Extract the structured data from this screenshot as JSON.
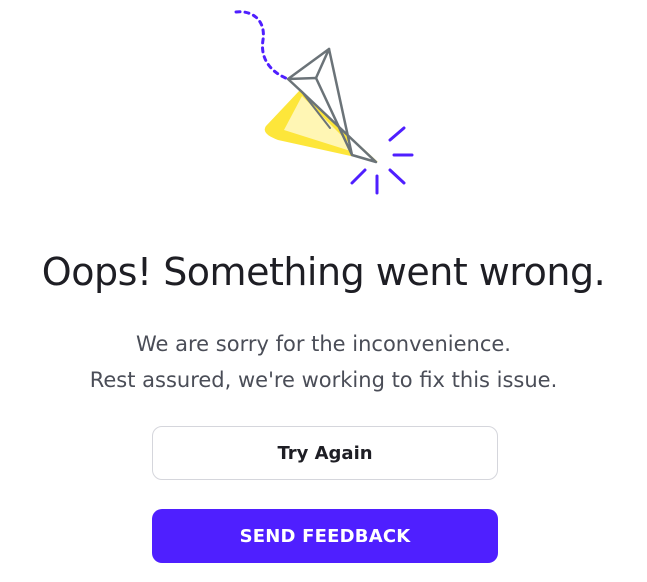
{
  "error": {
    "title": "Oops! Something went wrong.",
    "message_line1": "We are sorry for the inconvenience.",
    "message_line2": "Rest assured, we're working to fix this issue."
  },
  "actions": {
    "try_again_label": "Try Again",
    "send_feedback_label": "SEND FEEDBACK"
  },
  "illustration": {
    "icon": "paper-plane-icon"
  },
  "colors": {
    "primary": "#4f1fff",
    "highlight_yellow": "#fde63a",
    "plane_outline": "#6b7378",
    "title_text": "#1e1e24"
  }
}
